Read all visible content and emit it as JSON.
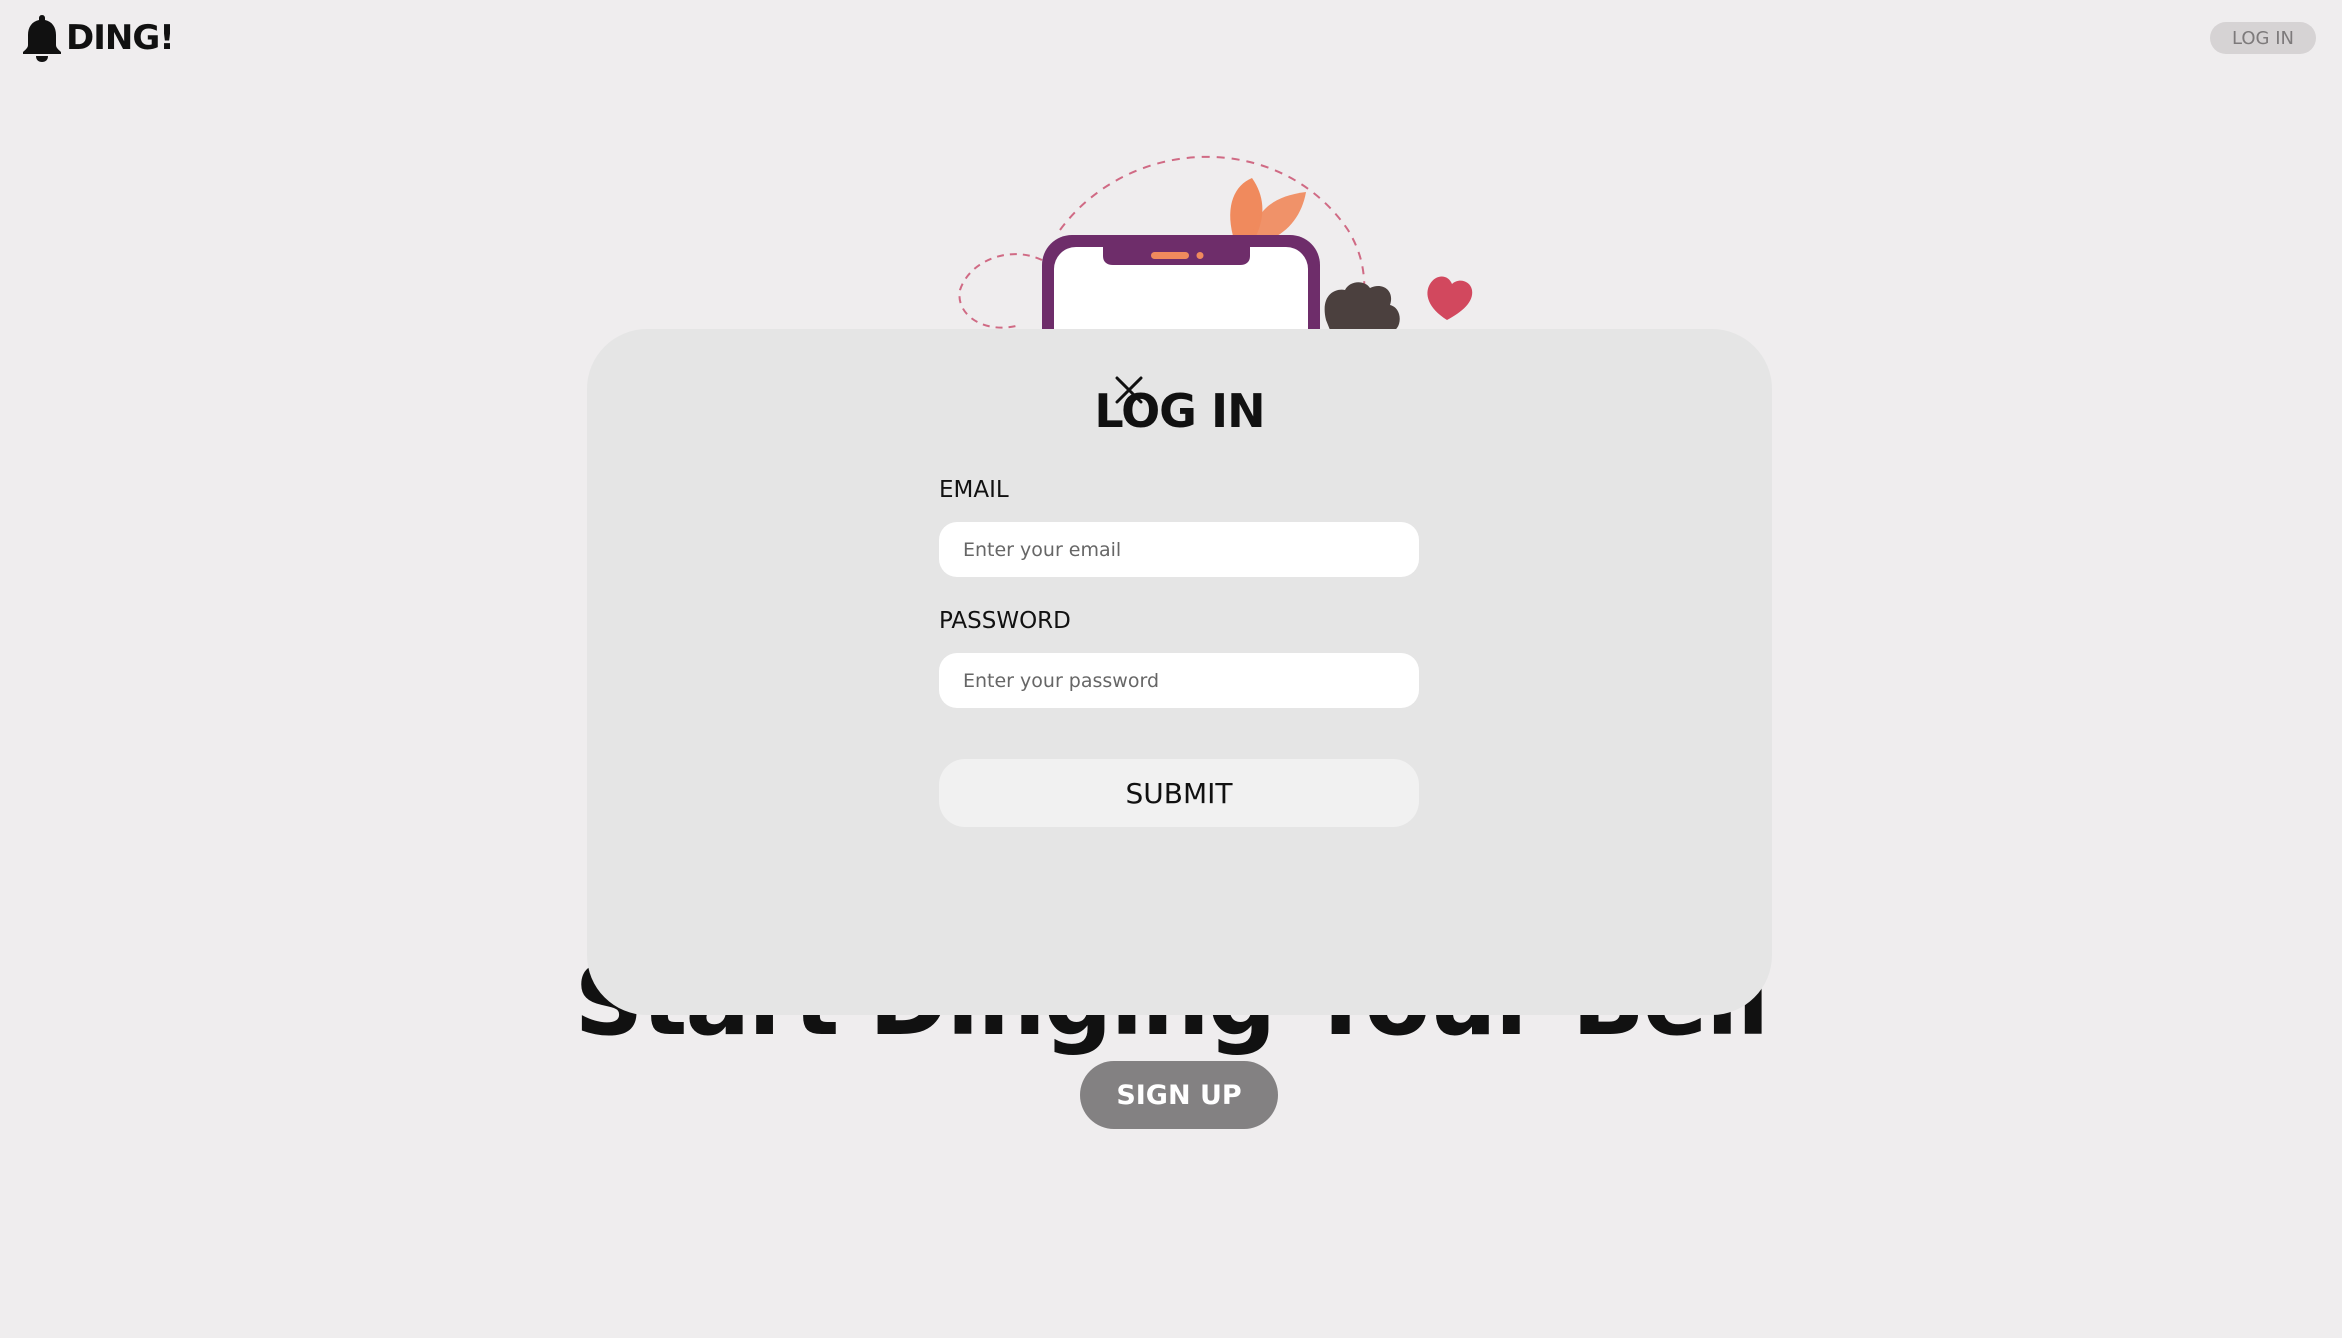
{
  "header": {
    "brand_name": "DING!",
    "login_label": "LOG IN"
  },
  "hero": {
    "title": "Start Dinging Your Bell",
    "signup_label": "SIGN UP"
  },
  "modal": {
    "title": "LOG IN",
    "email": {
      "label": "EMAIL",
      "placeholder": "Enter your email",
      "value": ""
    },
    "password": {
      "label": "PASSWORD",
      "placeholder": "Enter your password",
      "value": ""
    },
    "submit_label": "SUBMIT"
  },
  "icons": {
    "brand": "bell-icon",
    "close": "close-icon"
  },
  "colors": {
    "background": "#efedee",
    "modal": "#e5e5e5",
    "phone": "#6e2d6a",
    "leaf": "#f08a5d",
    "heart": "#d2485e",
    "signup_button": "#838182",
    "header_button": "#d6d3d4"
  }
}
